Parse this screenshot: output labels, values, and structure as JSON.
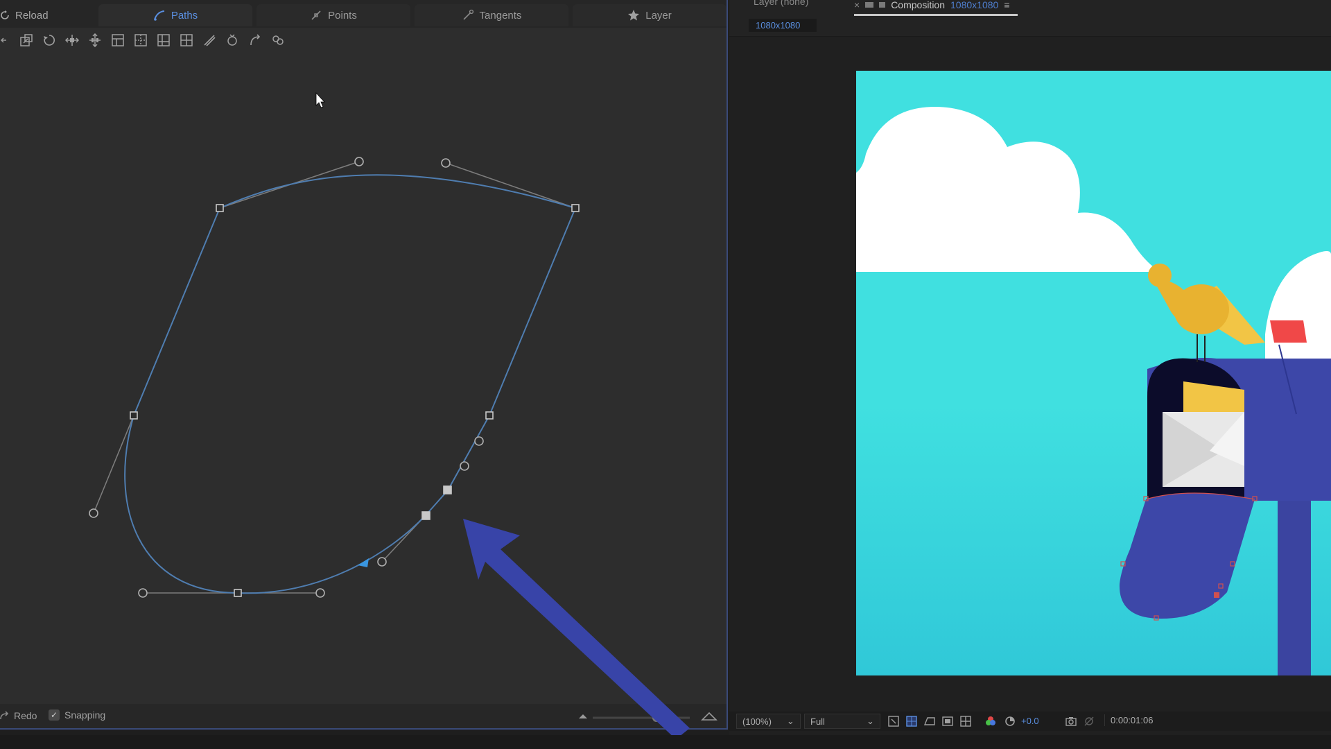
{
  "editor": {
    "reload_label": "Reload",
    "tabs": [
      {
        "label": "Paths",
        "icon": "path-icon",
        "active": true
      },
      {
        "label": "Points",
        "icon": "point-icon",
        "active": false
      },
      {
        "label": "Tangents",
        "icon": "tangent-icon",
        "active": false
      },
      {
        "label": "Layer",
        "icon": "star-icon",
        "active": false
      }
    ],
    "toolbar_icons": [
      "arrow-left-icon",
      "scale-icon",
      "rotate-icon",
      "move-horizontal-icon",
      "move-vertical-icon",
      "align-grid-icon",
      "distribute-icon",
      "grid-icon",
      "grid-split-icon",
      "knife-icon",
      "lasso-icon",
      "undo-curve-icon",
      "chain-icon"
    ],
    "redo_label": "Redo",
    "snapping_label": "Snapping",
    "snapping_checked": true
  },
  "viewer": {
    "layer_label": "Layer (none)",
    "comp_tab": {
      "name": "Composition",
      "size": "1080x1080"
    },
    "resolution_badge": "1080x1080",
    "zoom": "(100%)",
    "quality": "Full",
    "exposure": "+0.0",
    "timecode": "0:00:01:06"
  },
  "colors": {
    "panel_bg": "#2d2d2d",
    "accent_blue": "#5a8fe0",
    "path_stroke": "#4f7db0",
    "arrow_blue": "#3844a8",
    "sky": "#40e0e0",
    "mailbox": "#3d47a8",
    "bird": "#f2c545",
    "flag": "#f04848"
  }
}
